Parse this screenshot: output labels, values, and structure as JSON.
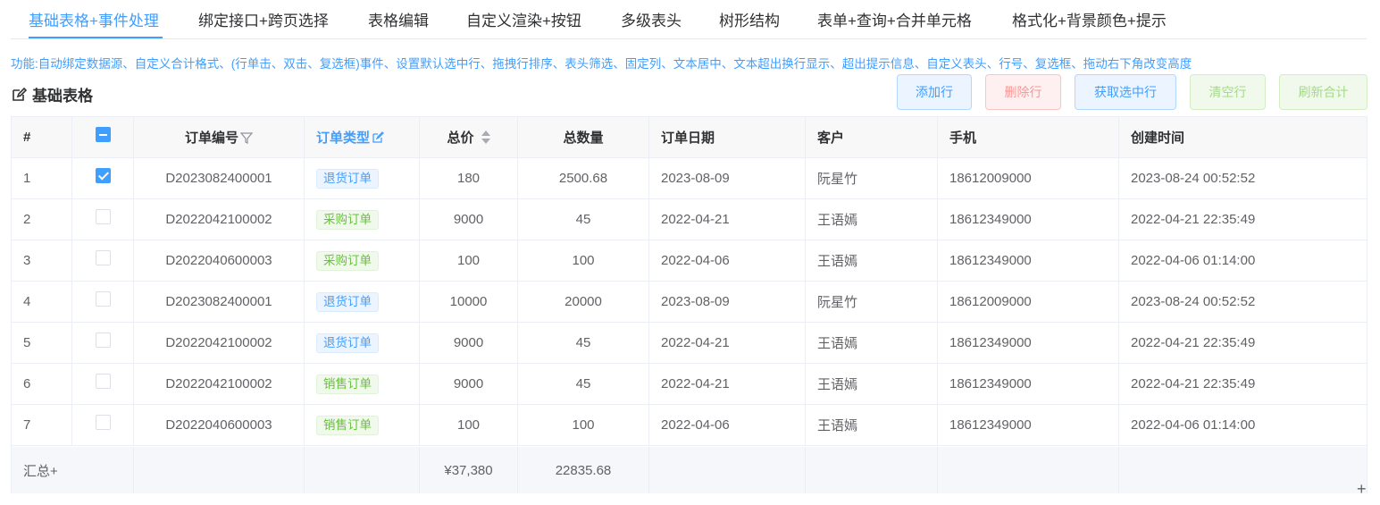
{
  "tabs": [
    "基础表格+事件处理",
    "绑定接口+跨页选择",
    "表格编辑",
    "自定义渲染+按钮",
    "多级表头",
    "树形结构",
    "表单+查询+合并单元格",
    "格式化+背景颜色+提示"
  ],
  "features": "功能:自动绑定数据源、自定义合计格式、(行单击、双击、复选框)事件、设置默认选中行、拖拽行排序、表头筛选、固定列、文本居中、文本超出换行显示、超出提示信息、自定义表头、行号、复选框、拖动右下角改变高度",
  "title": "基础表格",
  "buttons": {
    "add": "添加行",
    "delete": "删除行",
    "get_selected": "获取选中行",
    "clear": "清空行",
    "refresh_total": "刷新合计"
  },
  "table": {
    "headers": {
      "index": "#",
      "order_no": "订单编号",
      "order_type": "订单类型",
      "total_price": "总价",
      "total_qty": "总数量",
      "order_date": "订单日期",
      "customer": "客户",
      "phone": "手机",
      "created": "创建时间"
    },
    "rows": [
      {
        "index": "1",
        "checked": true,
        "order_no": "D2023082400001",
        "order_type": "退货订单",
        "tag_color": "blue",
        "total_price": "180",
        "total_qty": "2500.68",
        "order_date": "2023-08-09",
        "customer": "阮星竹",
        "phone": "18612009000",
        "created": "2023-08-24 00:52:52"
      },
      {
        "index": "2",
        "checked": false,
        "order_no": "D2022042100002",
        "order_type": "采购订单",
        "tag_color": "green",
        "total_price": "9000",
        "total_qty": "45",
        "order_date": "2022-04-21",
        "customer": "王语嫣",
        "phone": "18612349000",
        "created": "2022-04-21 22:35:49"
      },
      {
        "index": "3",
        "checked": false,
        "order_no": "D2022040600003",
        "order_type": "采购订单",
        "tag_color": "green",
        "total_price": "100",
        "total_qty": "100",
        "order_date": "2022-04-06",
        "customer": "王语嫣",
        "phone": "18612349000",
        "created": "2022-04-06 01:14:00"
      },
      {
        "index": "4",
        "checked": false,
        "order_no": "D2023082400001",
        "order_type": "退货订单",
        "tag_color": "blue",
        "total_price": "10000",
        "total_qty": "20000",
        "order_date": "2023-08-09",
        "customer": "阮星竹",
        "phone": "18612009000",
        "created": "2023-08-24 00:52:52"
      },
      {
        "index": "5",
        "checked": false,
        "order_no": "D2022042100002",
        "order_type": "退货订单",
        "tag_color": "blue",
        "total_price": "9000",
        "total_qty": "45",
        "order_date": "2022-04-21",
        "customer": "王语嫣",
        "phone": "18612349000",
        "created": "2022-04-21 22:35:49"
      },
      {
        "index": "6",
        "checked": false,
        "order_no": "D2022042100002",
        "order_type": "销售订单",
        "tag_color": "green",
        "total_price": "9000",
        "total_qty": "45",
        "order_date": "2022-04-21",
        "customer": "王语嫣",
        "phone": "18612349000",
        "created": "2022-04-21 22:35:49"
      },
      {
        "index": "7",
        "checked": false,
        "order_no": "D2022040600003",
        "order_type": "销售订单",
        "tag_color": "green",
        "total_price": "100",
        "total_qty": "100",
        "order_date": "2022-04-06",
        "customer": "王语嫣",
        "phone": "18612349000",
        "created": "2022-04-06 01:14:00"
      }
    ],
    "footer": {
      "label": "汇总+",
      "total_price": "¥37,380",
      "total_qty": "22835.68"
    }
  },
  "colors": {
    "accent": "#409eff",
    "tag_blue": "#409eff",
    "tag_green": "#67c23a",
    "danger": "#f89898"
  },
  "icons": {
    "title": "edit-icon",
    "order_no_header": "filter-icon",
    "order_type_header": "edit-icon",
    "total_price_header": "sort-icon",
    "resize": "plus-icon"
  },
  "resize_glyph": "+"
}
